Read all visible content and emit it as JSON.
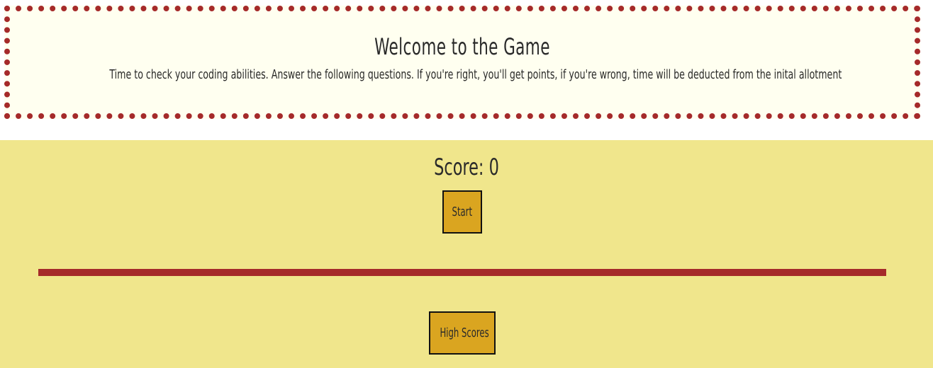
{
  "header": {
    "title": "Welcome to the Game",
    "intro": "Time to check your coding abilities. Answer the following questions. If you're right, you'll get points, if you're wrong, time will be deducted from the inital allotment"
  },
  "game": {
    "score_label": "Score: ",
    "score_value": "0",
    "start_label": "Start",
    "high_scores_label": "High Scores"
  },
  "colors": {
    "accent": "#a52a2a",
    "header_bg": "#fffff0",
    "main_bg": "#f0e68c",
    "button_bg": "#daa520"
  }
}
